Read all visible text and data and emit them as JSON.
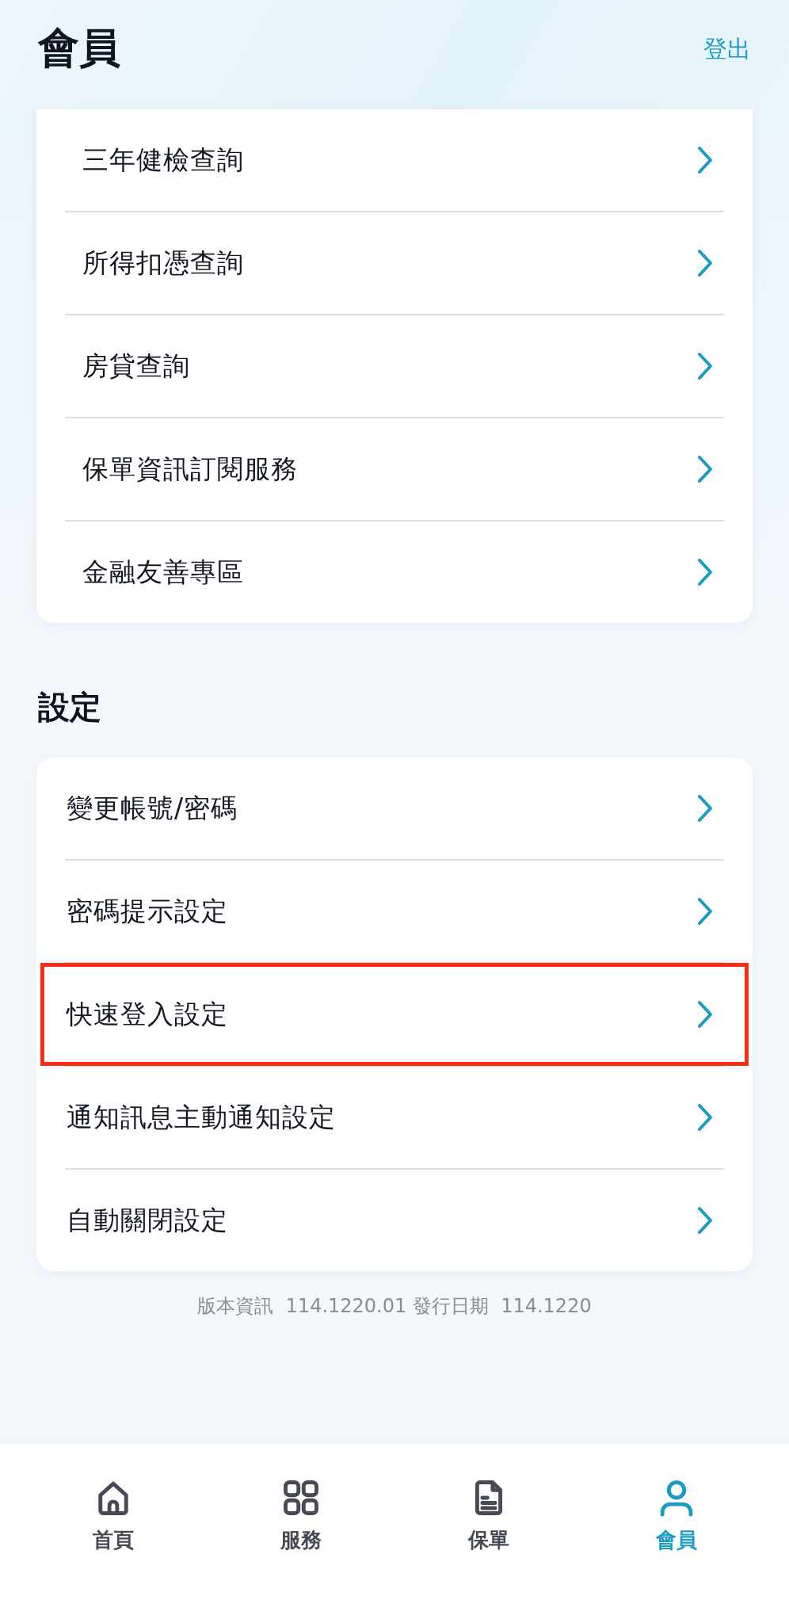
{
  "header": {
    "title": "會員",
    "logout": "登出"
  },
  "sections": [
    {
      "items": [
        {
          "label": "三年健檢查詢",
          "highlighted": false
        },
        {
          "label": "所得扣憑查詢",
          "highlighted": false
        },
        {
          "label": "房貸查詢",
          "highlighted": false
        },
        {
          "label": "保單資訊訂閱服務",
          "highlighted": false
        },
        {
          "label": "金融友善專區",
          "highlighted": false
        }
      ]
    },
    {
      "title": "設定",
      "items": [
        {
          "label": "變更帳號/密碼",
          "highlighted": false
        },
        {
          "label": "密碼提示設定",
          "highlighted": false
        },
        {
          "label": "快速登入設定",
          "highlighted": true
        },
        {
          "label": "通知訊息主動通知設定",
          "highlighted": false
        },
        {
          "label": "自動關閉設定",
          "highlighted": false
        }
      ]
    }
  ],
  "version": "版本資訊  114.1220.01 發行日期  114.1220",
  "tabs": [
    {
      "label": "首頁",
      "kind": "home",
      "selected": false
    },
    {
      "label": "服務",
      "kind": "grid",
      "selected": false
    },
    {
      "label": "保單",
      "kind": "document",
      "selected": false
    },
    {
      "label": "會員",
      "kind": "person",
      "selected": true
    }
  ]
}
